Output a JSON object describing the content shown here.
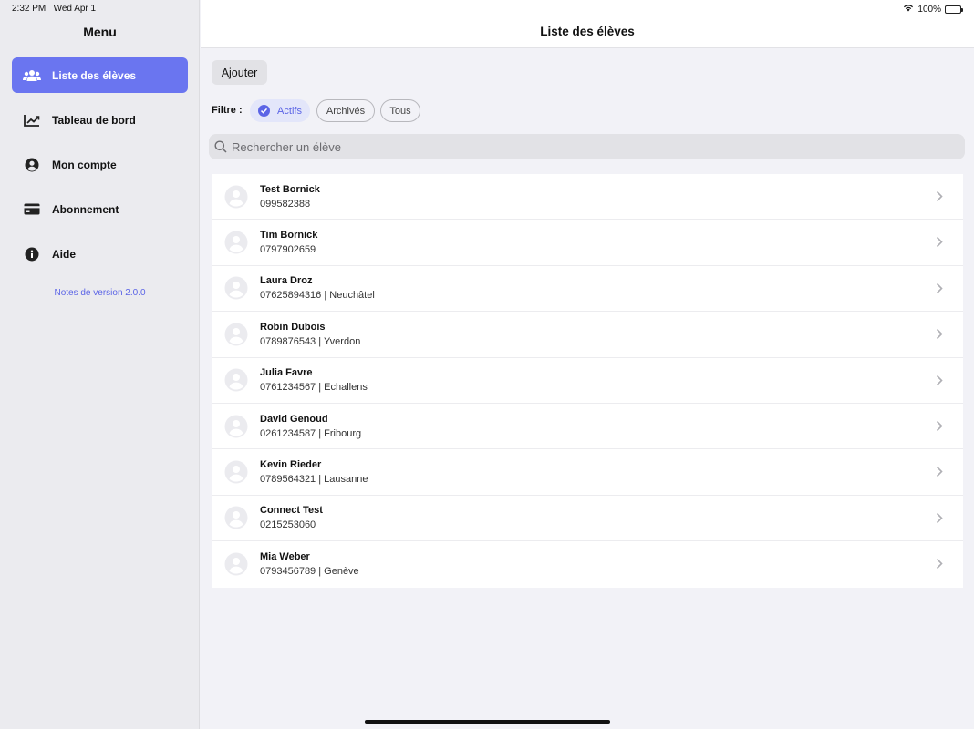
{
  "status": {
    "time": "2:32 PM",
    "date": "Wed Apr 1",
    "battery": "100%"
  },
  "sidebar": {
    "title": "Menu",
    "items": [
      {
        "label": "Liste des élèves",
        "icon": "users-icon",
        "active": true
      },
      {
        "label": "Tableau de bord",
        "icon": "chart-line-icon",
        "active": false
      },
      {
        "label": "Mon compte",
        "icon": "user-circle-icon",
        "active": false
      },
      {
        "label": "Abonnement",
        "icon": "credit-card-icon",
        "active": false
      },
      {
        "label": "Aide",
        "icon": "info-icon",
        "active": false
      }
    ],
    "version_link": "Notes de version 2.0.0"
  },
  "header": {
    "title": "Liste des élèves"
  },
  "toolbar": {
    "add_label": "Ajouter"
  },
  "filter": {
    "label": "Filtre :",
    "options": [
      "Actifs",
      "Archivés",
      "Tous"
    ],
    "selected": "Actifs"
  },
  "search": {
    "placeholder": "Rechercher un élève",
    "value": ""
  },
  "students": [
    {
      "name": "Test Bornick",
      "detail": "099582388"
    },
    {
      "name": "Tim Bornick",
      "detail": "0797902659"
    },
    {
      "name": "Laura Droz",
      "detail": "07625894316 | Neuchâtel"
    },
    {
      "name": "Robin Dubois",
      "detail": "0789876543 | Yverdon"
    },
    {
      "name": "Julia Favre",
      "detail": "0761234567 | Echallens"
    },
    {
      "name": "David Genoud",
      "detail": "0261234587 | Fribourg"
    },
    {
      "name": "Kevin Rieder",
      "detail": "0789564321 | Lausanne"
    },
    {
      "name": "Connect Test",
      "detail": "0215253060"
    },
    {
      "name": "Mia Weber",
      "detail": "0793456789 | Genève"
    }
  ],
  "colors": {
    "accent": "#6a75f0",
    "link": "#5b64e6",
    "background": "#f2f2f7",
    "sidebar": "#ebebef"
  }
}
